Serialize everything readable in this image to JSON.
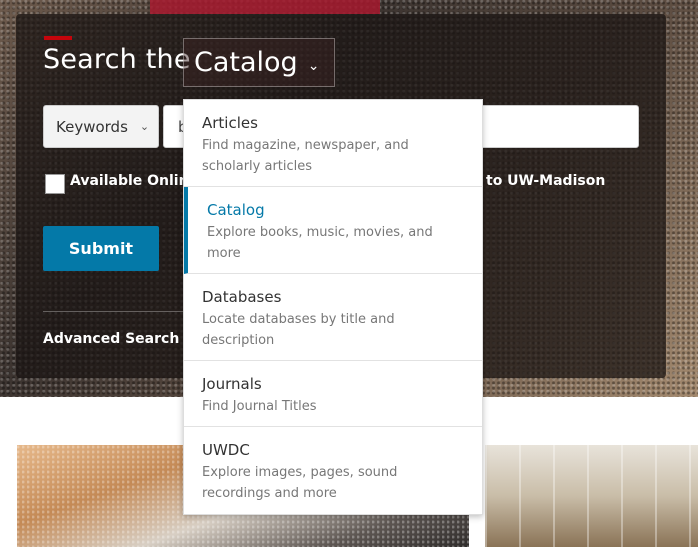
{
  "search": {
    "heading_prefix": "Search the",
    "selected_source": "Catalog",
    "field_select": "Keywords",
    "input_value": "b",
    "checkbox_label_start": "Available Online",
    "checkbox_label_end": "to UW-Madison",
    "submit_label": "Submit",
    "advanced_label": "Advanced Search"
  },
  "dropdown": {
    "items": [
      {
        "title": "Articles",
        "description": "Find magazine, newspaper, and scholarly articles",
        "active": false
      },
      {
        "title": "Catalog",
        "description": "Explore books, music, movies, and more",
        "active": true
      },
      {
        "title": "Databases",
        "description": "Locate databases by title and description",
        "active": false
      },
      {
        "title": "Journals",
        "description": "Find Journal Titles",
        "active": false
      },
      {
        "title": "UWDC",
        "description": "Explore images, pages, sound recordings and more",
        "active": false
      }
    ]
  },
  "colors": {
    "accent_red": "#c5050c",
    "link_blue": "#0479a8",
    "submit_blue": "#0479a8"
  }
}
